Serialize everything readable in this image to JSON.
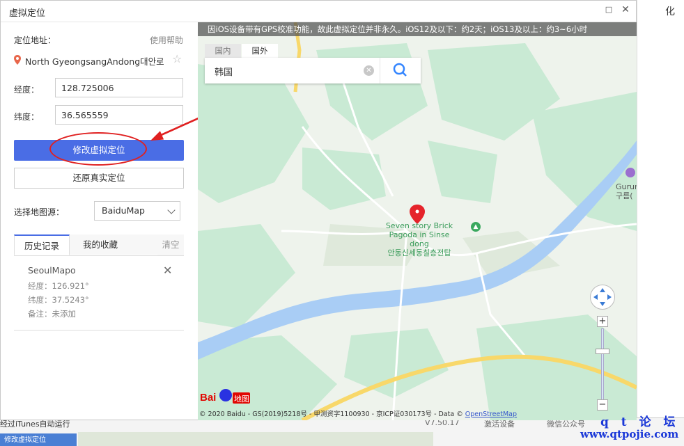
{
  "dialog": {
    "title": "虚拟定位"
  },
  "left": {
    "address_label": "定位地址：",
    "help_link": "使用帮助",
    "address_value": "North GyeongsangAndong대안로",
    "longitude_label": "经度：",
    "longitude_value": "128.725006",
    "latitude_label": "纬度：",
    "latitude_value": "36.565559",
    "modify_button": "修改虚拟定位",
    "restore_button": "还原真实定位",
    "map_source_label": "选择地图源：",
    "map_source_value": "BaiduMap",
    "tabs": {
      "history": "历史记录",
      "favorites": "我的收藏",
      "clear": "清空"
    },
    "history_item": {
      "name": "SeoulMapo",
      "longitude": "经度：126.921°",
      "latitude": "纬度：37.5243°",
      "note": "备注：未添加"
    }
  },
  "map": {
    "notice": "因iOS设备带有GPS校准功能，故此虚拟定位并非永久。iOS12及以下：约2天；iOS13及以上：约3~6小时",
    "tab_domestic": "国内",
    "tab_foreign": "国外",
    "search_value": "韩国",
    "poi_line1": "Seven story Brick",
    "poi_line2": "Pagoda in Sinse dong",
    "poi_line3": "안동신세동칠층전탑",
    "place_line1": "Gurun",
    "place_line2": "구름(",
    "zoom_in": "+",
    "zoom_out": "−",
    "logo_text": "Bai",
    "logo_text2": "地图",
    "copyright": "© 2020 Baidu - GS(2019)5218号 - 甲测资字1100930 - 京ICP证030173号 - Data ©",
    "copyright_link": "OpenStreetMap"
  },
  "background": {
    "bottom_left_text": "经过iTunes自动运行",
    "bottom_mid1": "V7.50.17",
    "bottom_mid2": "激活设备",
    "bottom_mid3": "微信公众号",
    "bottom_button": "修改虚拟定位",
    "watermark_line1": "q t 论 坛",
    "watermark_line2": "www.qtpojie.com",
    "top_right_glyph": "化"
  },
  "colors": {
    "primary": "#4a6de5",
    "annotation_red": "#e02020",
    "water": "#a9cdf5",
    "vegetation": "#c5e8cf",
    "road_major": "#f8d86a",
    "watermark": "#1a38d8"
  }
}
